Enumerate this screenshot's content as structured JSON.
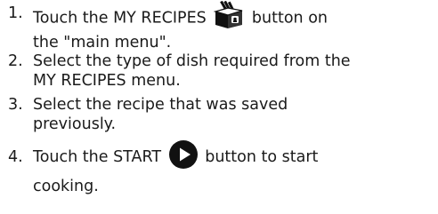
{
  "steps": [
    {
      "number": "1.",
      "line1_before": "Touch the MY RECIPES",
      "line1_after": "button on",
      "line2": "the \"main menu\".",
      "icon": "recipe-book-icon"
    },
    {
      "number": "2.",
      "line1": "Select the type of dish required from the",
      "line2": "MY RECIPES menu."
    },
    {
      "number": "3.",
      "line1": "Select the recipe that was saved",
      "line2": "previously."
    },
    {
      "number": "4.",
      "line1_before": "Touch the START",
      "line1_after": "button to start",
      "line2": "cooking.",
      "icon": "play-icon"
    }
  ],
  "colors": {
    "text": "#1a1a1a",
    "icon": "#111111"
  }
}
